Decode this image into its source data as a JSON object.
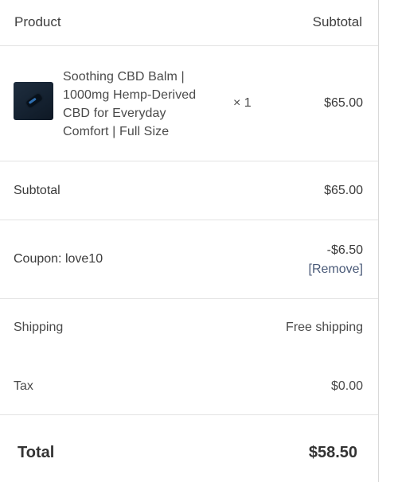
{
  "header": {
    "product_label": "Product",
    "subtotal_label": "Subtotal"
  },
  "line_item": {
    "name_lines": [
      "Soothing CBD Balm |",
      "1000mg Hemp-Derived",
      "CBD for Everyday",
      "Comfort | Full Size"
    ],
    "quantity": "× 1",
    "price": "$65.00"
  },
  "subtotal": {
    "label": "Subtotal",
    "value": "$65.00"
  },
  "coupon": {
    "label": "Coupon: love10",
    "amount": "-$6.50",
    "remove_label": "[Remove]"
  },
  "shipping": {
    "label": "Shipping",
    "value": "Free shipping"
  },
  "tax": {
    "label": "Tax",
    "value": "$0.00"
  },
  "total": {
    "label": "Total",
    "value": "$58.50"
  },
  "colors": {
    "link": "#4a5a78",
    "divider": "#e3e3e3",
    "text": "#3b3b3b"
  }
}
